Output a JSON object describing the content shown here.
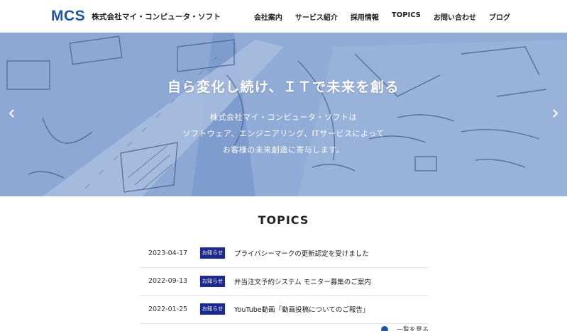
{
  "header": {
    "logo": "MCS",
    "company": "株式会社マイ・コンピュータ・ソフト",
    "nav": [
      "会社案内",
      "サービス紹介",
      "採用情報",
      "TOPICS",
      "お問い合わせ",
      "ブログ"
    ]
  },
  "hero": {
    "title": "自ら変化し続け、ＩＴで未来を創る",
    "lines": [
      "株式会社マイ・コンピュータ・ソフトは",
      "ソフトウェア、エンジニアリング、ITサービスによって",
      "お客様の未来創造に寄与します。"
    ],
    "prev_icon": "chevron-left-icon",
    "next_icon": "chevron-right-icon"
  },
  "topics": {
    "title": "TOPICS",
    "items": [
      {
        "date": "2023-04-17",
        "badge": "お知らせ",
        "text": "プライバシーマークの更新認定を受けました"
      },
      {
        "date": "2022-09-13",
        "badge": "お知らせ",
        "text": "弁当注文予約システム モニター募集のご案内"
      },
      {
        "date": "2022-01-25",
        "badge": "お知らせ",
        "text": "YouTube動画「動画投稿についてのご報告」"
      }
    ],
    "more_label": "一覧を見る"
  },
  "colors": {
    "brand": "#1f56a8",
    "badge": "#1b2a8c",
    "hero_tint": "#7f9fcf"
  }
}
